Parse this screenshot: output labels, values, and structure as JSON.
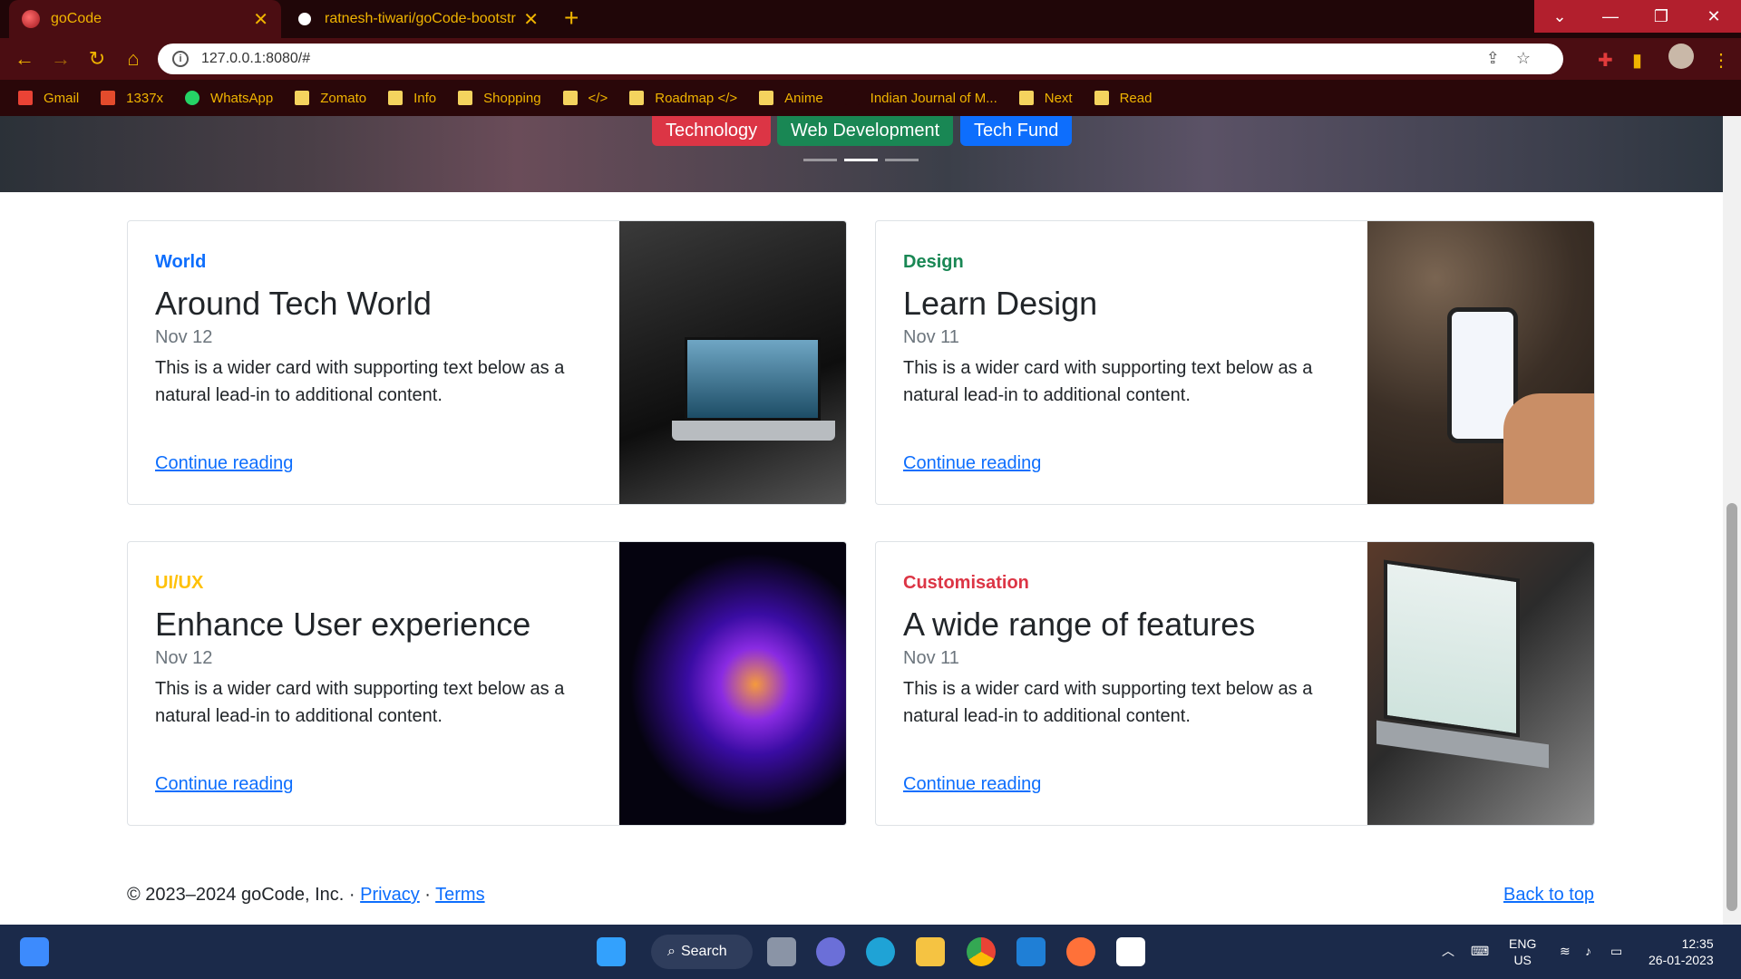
{
  "browser": {
    "tabs": [
      {
        "title": "goCode",
        "active": true
      },
      {
        "title": "ratnesh-tiwari/goCode-bootstrap",
        "active": false
      }
    ],
    "new_tab": "+",
    "url": "127.0.0.1:8080/#",
    "bookmarks": [
      {
        "label": "Gmail",
        "icon": "gmail-icon",
        "color": "#ea4335"
      },
      {
        "label": "1337x",
        "icon": "x-icon",
        "color": "#e34b2c"
      },
      {
        "label": "WhatsApp",
        "icon": "whatsapp-icon",
        "color": "#25d366"
      },
      {
        "label": "Zomato",
        "icon": "folder-icon",
        "color": "#f4d35e"
      },
      {
        "label": "Info",
        "icon": "folder-icon",
        "color": "#f4d35e"
      },
      {
        "label": "Shopping",
        "icon": "folder-icon",
        "color": "#f4d35e"
      },
      {
        "label": "</>",
        "icon": "folder-icon",
        "color": "#f4d35e"
      },
      {
        "label": "Roadmap </>",
        "icon": "folder-icon",
        "color": "#f4d35e"
      },
      {
        "label": "Anime",
        "icon": "folder-icon",
        "color": "#f4d35e"
      },
      {
        "label": "Indian Journal of M...",
        "icon": "page-icon",
        "color": "#2a0709"
      },
      {
        "label": "Next",
        "icon": "folder-icon",
        "color": "#f4d35e"
      },
      {
        "label": "Read",
        "icon": "folder-icon",
        "color": "#f4d35e"
      }
    ]
  },
  "hero": {
    "badges": [
      {
        "label": "Technology",
        "color": "#dc3545"
      },
      {
        "label": "Web Development",
        "color": "#198754"
      },
      {
        "label": "Tech Fund",
        "color": "#0d6efd"
      }
    ],
    "active_slide": 2,
    "slide_count": 3
  },
  "cards": [
    {
      "category": "World",
      "category_color": "#0d6efd",
      "title": "Around Tech World",
      "date": "Nov 12",
      "text": "This is a wider card with supporting text below as a natural lead-in to additional content.",
      "link": "Continue reading",
      "image": "laptop-photo"
    },
    {
      "category": "Design",
      "category_color": "#198754",
      "title": "Learn Design",
      "date": "Nov 11",
      "text": "This is a wider card with supporting text below as a natural lead-in to additional content.",
      "link": "Continue reading",
      "image": "phone-photo"
    },
    {
      "category": "UI/UX",
      "category_color": "#ffc107",
      "title": "Enhance User experience",
      "date": "Nov 12",
      "text": "This is a wider card with supporting text below as a natural lead-in to additional content.",
      "link": "Continue reading",
      "image": "abstract-gradient"
    },
    {
      "category": "Customisation",
      "category_color": "#dc3545",
      "title": "A wide range of features",
      "date": "Nov 11",
      "text": "This is a wider card with supporting text below as a natural lead-in to additional content.",
      "link": "Continue reading",
      "image": "dashboard-laptop-photo"
    }
  ],
  "footer": {
    "copyright": "© 2023–2024 goCode, Inc. · ",
    "privacy": "Privacy",
    "sep": " · ",
    "terms": "Terms",
    "back_to_top": "Back to top"
  },
  "taskbar": {
    "search": "Search",
    "lang1": "ENG",
    "lang2": "US",
    "time": "12:35",
    "date": "26-01-2023"
  }
}
